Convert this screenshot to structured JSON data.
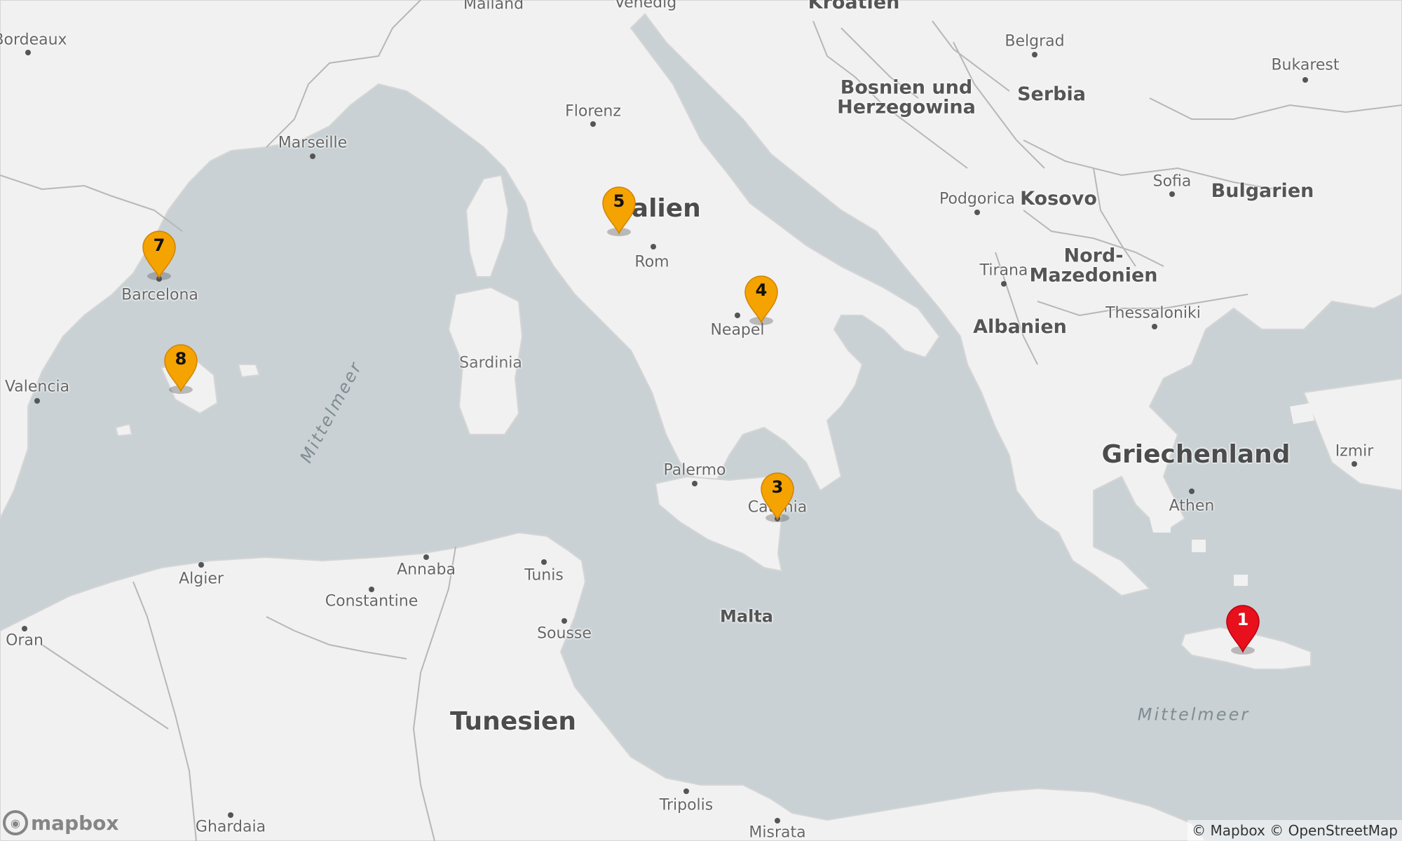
{
  "map": {
    "water_color": "#c9d1d4",
    "land_color": "#f1f1f1",
    "border_color": "#b8b8b8"
  },
  "labels": {
    "bordeaux": "Bordeaux",
    "marseille": "Marseille",
    "barcelona": "Barcelona",
    "valencia": "Valencia",
    "florenz": "Florenz",
    "rom": "Rom",
    "neapel": "Neapel",
    "palermo": "Palermo",
    "catania": "Catania",
    "belgrad": "Belgrad",
    "bukarest": "Bukarest",
    "sofia": "Sofia",
    "podgorica": "Podgorica",
    "tirana": "Tirana",
    "thessaloniki": "Thessaloniki",
    "athen": "Athen",
    "izmir": "Izmir",
    "algier": "Algier",
    "annaba": "Annaba",
    "constantine": "Constantine",
    "tunis": "Tunis",
    "sousse": "Sousse",
    "oran": "Oran",
    "tripolis": "Tripolis",
    "misrata": "Misrata",
    "ghardaia": "Ghardaia",
    "sardinia": "Sardinia",
    "malta": "Malta",
    "italien": "Italien",
    "bosnien": "Bosnien und\nHerzegowina",
    "serbia": "Serbia",
    "kosovo": "Kosovo",
    "bulgarien": "Bulgarien",
    "nordmazedonien": "Nord-\nMazedonien",
    "albanien": "Albanien",
    "griechenland": "Griechenland",
    "tunesien": "Tunesien",
    "mittelmeer_west": "Mittelmeer",
    "mittelmeer_east": "Mittelmeer",
    "kroatien": "Kroatien",
    "venedig": "Venedig",
    "mailand": "Mailand"
  },
  "markers": [
    {
      "id": "1",
      "label": "1",
      "color": "#e8101c",
      "text_color": "#ffffff"
    },
    {
      "id": "3",
      "label": "3",
      "color": "#f5a300",
      "text_color": "#111111"
    },
    {
      "id": "4",
      "label": "4",
      "color": "#f5a300",
      "text_color": "#111111"
    },
    {
      "id": "5",
      "label": "5",
      "color": "#f5a300",
      "text_color": "#111111"
    },
    {
      "id": "7",
      "label": "7",
      "color": "#f5a300",
      "text_color": "#111111"
    },
    {
      "id": "8",
      "label": "8",
      "color": "#f5a300",
      "text_color": "#111111"
    }
  ],
  "logo": {
    "text": "mapbox"
  },
  "attribution": {
    "text": "© Mapbox © OpenStreetMap"
  }
}
